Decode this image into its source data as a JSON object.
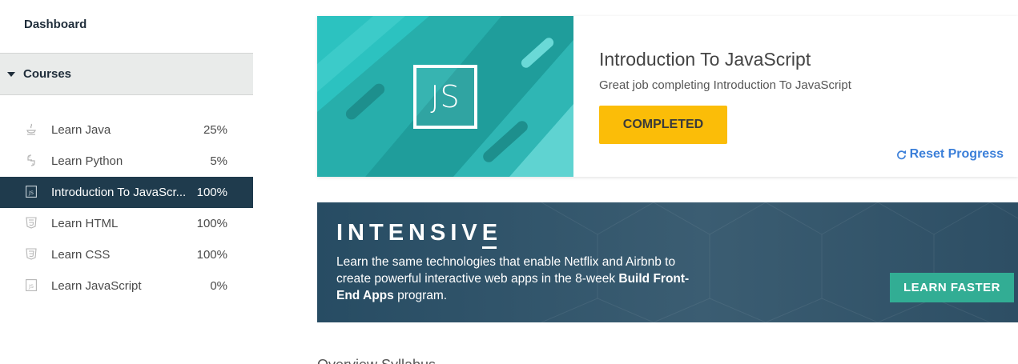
{
  "sidebar": {
    "dashboard_label": "Dashboard",
    "courses_label": "Courses",
    "courses": [
      {
        "name": "Learn Java",
        "percent": "25%",
        "icon": "java-icon"
      },
      {
        "name": "Learn Python",
        "percent": "5%",
        "icon": "python-icon"
      },
      {
        "name": "Introduction To JavaScript",
        "display_name": "Introduction To JavaScr...",
        "percent": "100%",
        "icon": "js-icon",
        "active": true
      },
      {
        "name": "Learn HTML",
        "percent": "100%",
        "icon": "html5-icon"
      },
      {
        "name": "Learn CSS",
        "percent": "100%",
        "icon": "css3-icon"
      },
      {
        "name": "Learn JavaScript",
        "percent": "0%",
        "icon": "js-icon"
      }
    ]
  },
  "course_card": {
    "badge_text": "JS",
    "title": "Introduction To JavaScript",
    "subtitle": "Great job completing Introduction To JavaScript",
    "completed_label": "COMPLETED",
    "reset_label": "Reset Progress"
  },
  "banner": {
    "title": "INTENSIVE",
    "text_before": "Learn the same technologies that enable Netflix and Airbnb to create powerful interactive web apps in the 8-week ",
    "text_bold": "Build Front-End Apps",
    "text_after": " program.",
    "button_label": "LEARN FASTER"
  },
  "bottom_heading": "Overview Syllabus",
  "colors": {
    "active_bg": "#1f3b4d",
    "completed_yellow": "#fbbd08",
    "reset_blue": "#3b7fd9",
    "teal_button": "#32ad94",
    "card_teal": "#2ec4c2"
  }
}
